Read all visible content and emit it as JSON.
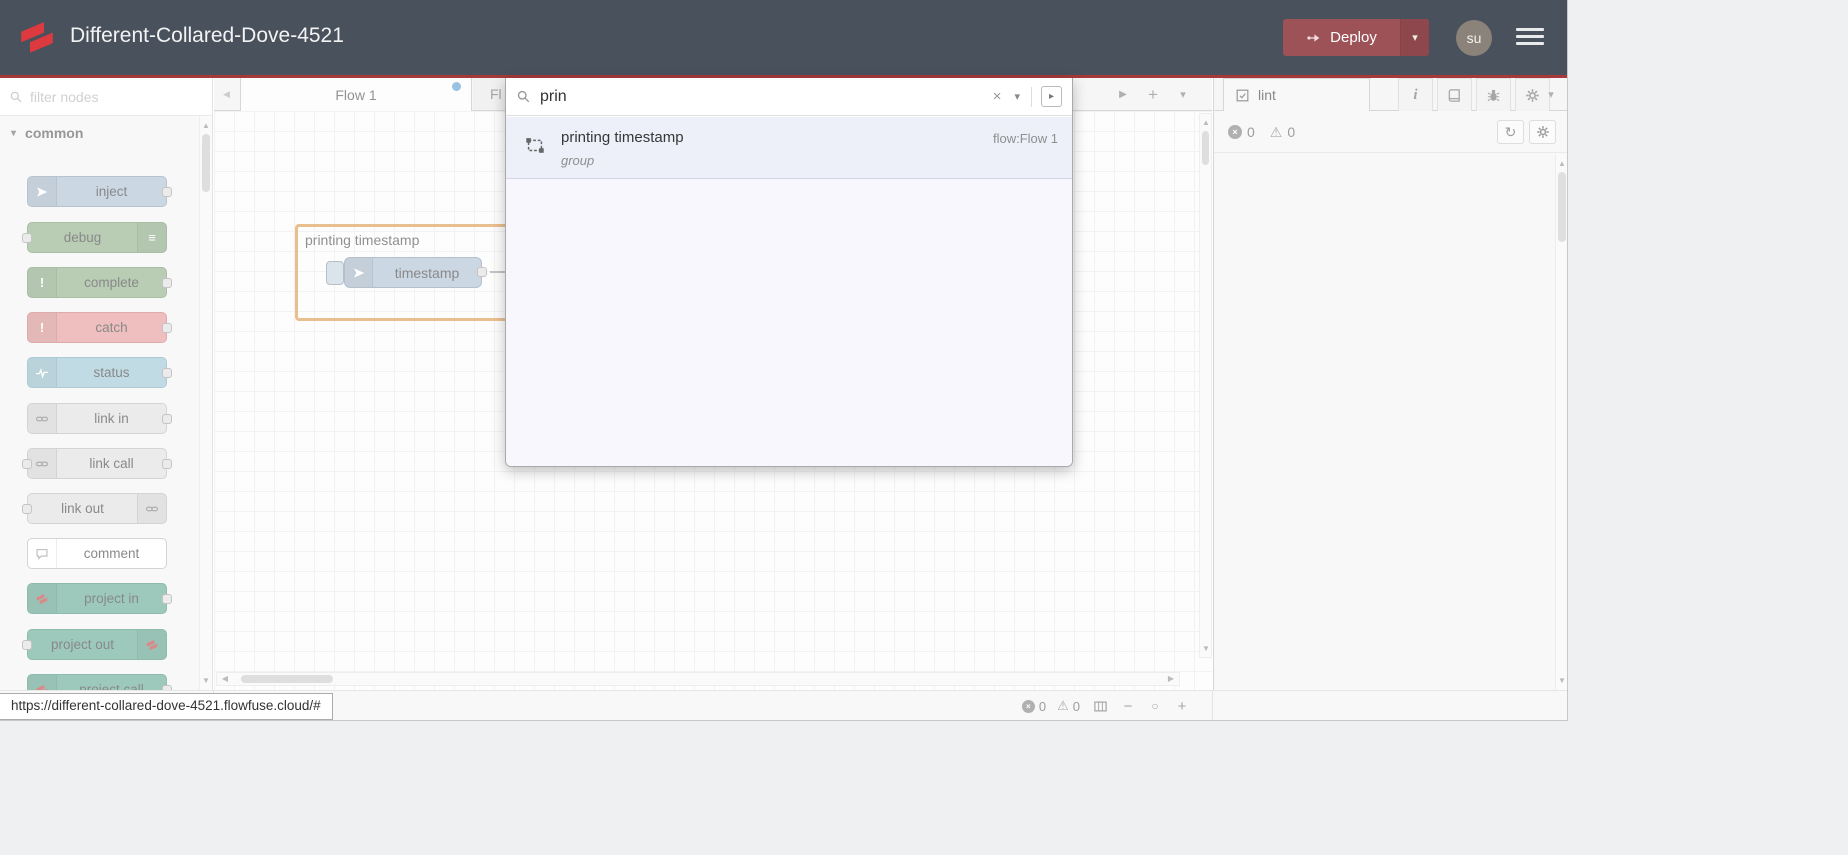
{
  "window": {
    "url_status": "https://different-collared-dove-4521.flowfuse.cloud/#"
  },
  "header": {
    "title": "Different-Collared-Dove-4521",
    "deploy_label": "Deploy",
    "avatar_text": "su"
  },
  "palette": {
    "search_placeholder": "filter nodes",
    "category_label": "common",
    "nodes": [
      {
        "label": "inject",
        "color": "#a6bbcf"
      },
      {
        "label": "debug",
        "color": "#87a980"
      },
      {
        "label": "complete",
        "color": "#87a980"
      },
      {
        "label": "catch",
        "color": "#e49191"
      },
      {
        "label": "status",
        "color": "#94c1d0"
      },
      {
        "label": "link in",
        "color": "#dddddd"
      },
      {
        "label": "link call",
        "color": "#dddddd"
      },
      {
        "label": "link out",
        "color": "#dddddd"
      },
      {
        "label": "comment",
        "color": "#ffffff"
      },
      {
        "label": "project in",
        "color": "#55a38a"
      },
      {
        "label": "project out",
        "color": "#55a38a"
      },
      {
        "label": "project call",
        "color": "#55a38a"
      }
    ]
  },
  "workspace": {
    "tabs": [
      {
        "label": "Flow 1",
        "active": true,
        "modified": true
      },
      {
        "label": "Fl",
        "active": false,
        "modified": false
      }
    ],
    "group_label": "printing timestamp",
    "node_label": "timestamp",
    "footer": {
      "error_count": "0",
      "warning_count": "0"
    }
  },
  "search": {
    "query": "prin",
    "results": [
      {
        "title": "printing timestamp",
        "location": "flow:Flow 1",
        "type": "group"
      }
    ]
  },
  "sidebar": {
    "tab_label": "lint",
    "error_count": "0",
    "warning_count": "0"
  },
  "icons": {
    "close": "×",
    "chevron_down": "▾",
    "caret_right": "▸",
    "caret_left": "◀",
    "tri_right": "▶",
    "tri_up": "▲",
    "tri_down": "▼",
    "plus": "+",
    "minus": "−",
    "circle": "○",
    "warning": "⚠",
    "refresh": "↻",
    "lines": "≡",
    "exclaim": "!",
    "info": "i"
  },
  "colors": {
    "header_bg": "#49515c",
    "accent_red_line": "#a63a3a",
    "deploy_red": "#9c5257",
    "brand_red": "#dd3a40",
    "modified_dot": "#4f94cd",
    "group_selected_border": "#d9913e",
    "node_inject": "#a6bbcf",
    "node_debug": "#87a980",
    "node_catch": "#e49191",
    "node_status": "#94c1d0",
    "node_link": "#dddddd",
    "node_comment": "#ffffff",
    "node_project": "#55a38a",
    "result_highlight": "#edeff9"
  }
}
